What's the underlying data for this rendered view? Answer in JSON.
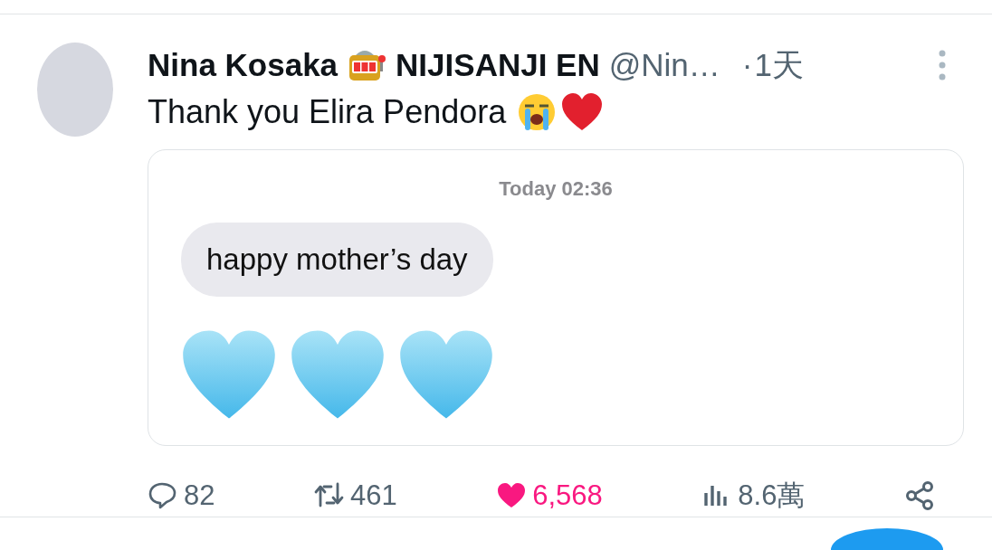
{
  "post": {
    "display_name": "Nina Kosaka",
    "affiliation": "NIJISANJI EN",
    "handle": "@Nin…",
    "separator": "·",
    "time": "1天",
    "text": "Thank you Elira Pendora"
  },
  "quoted_screenshot": {
    "timestamp": "Today 02:36",
    "message": "happy mother’s day",
    "hearts": [
      {
        "kind": "blue_heart"
      },
      {
        "kind": "blue_heart"
      },
      {
        "kind": "blue_heart"
      }
    ]
  },
  "actions": [
    {
      "kind": "reply",
      "count": "82",
      "selected": false
    },
    {
      "kind": "repost",
      "count": "461",
      "selected": false
    },
    {
      "kind": "like",
      "count": "6,568",
      "selected": true
    },
    {
      "kind": "views",
      "count": "8.6萬",
      "selected": false
    },
    {
      "kind": "share",
      "selected": false
    }
  ]
}
